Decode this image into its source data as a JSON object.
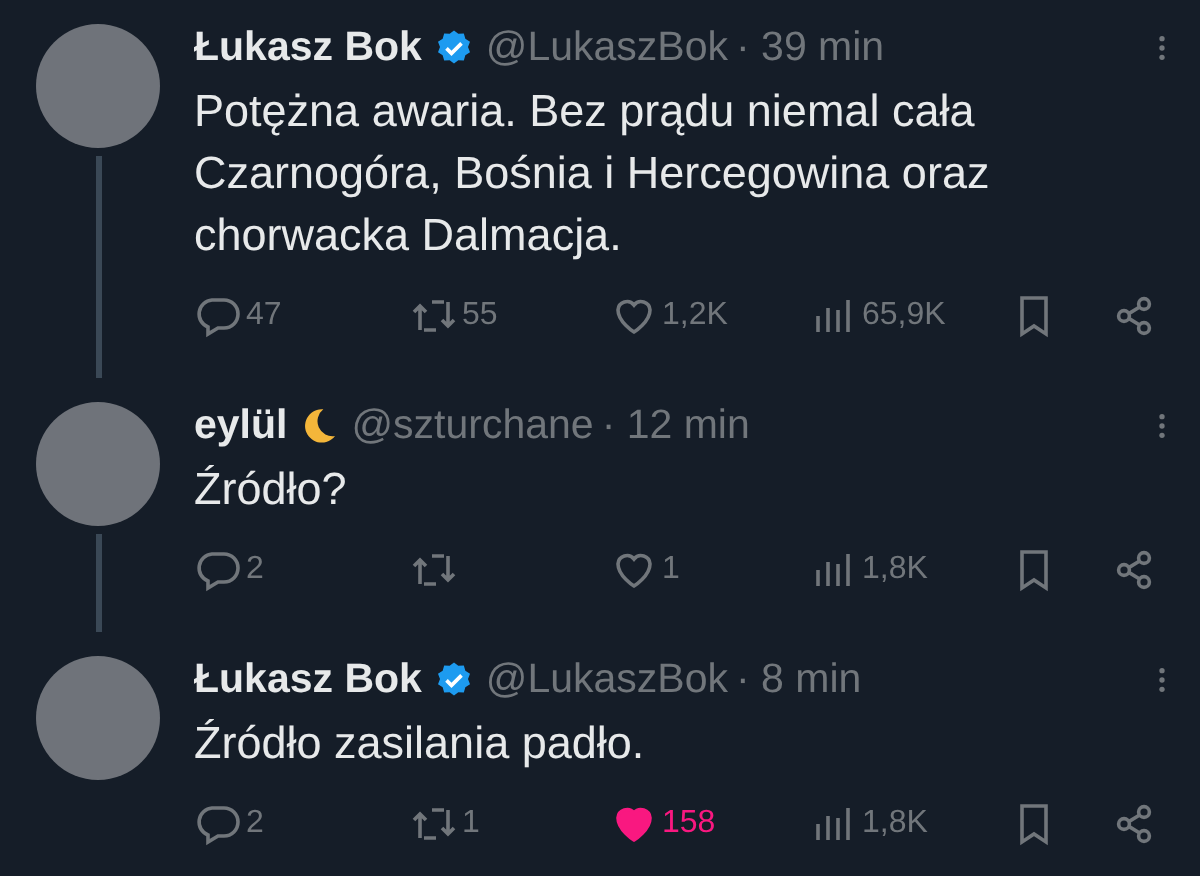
{
  "tweets": [
    {
      "name": "Łukasz Bok",
      "verified": true,
      "badge_emoji": false,
      "handle": "@LukaszBok",
      "time": "· 39 min",
      "text": "Potężna awaria. Bez prądu niemal cała Czarnogóra, Bośnia i Hercegowina oraz chorwacka Dalmacja.",
      "thread_continues": true,
      "replies": "47",
      "reposts": "55",
      "likes": "1,2K",
      "liked": false,
      "views": "65,9K"
    },
    {
      "name": "eylül",
      "verified": false,
      "badge_emoji": true,
      "handle": "@szturchane",
      "time": "· 12 min",
      "text": "Źródło?",
      "thread_continues": true,
      "replies": "2",
      "likes": "1",
      "liked": false,
      "views": "1,8K"
    },
    {
      "name": "Łukasz Bok",
      "verified": true,
      "badge_emoji": false,
      "handle": "@LukaszBok",
      "time": "· 8 min",
      "text": "Źródło zasilania padło.",
      "thread_continues": false,
      "replies": "2",
      "reposts": "1",
      "likes": "158",
      "liked": true,
      "views": "1,8K"
    }
  ]
}
